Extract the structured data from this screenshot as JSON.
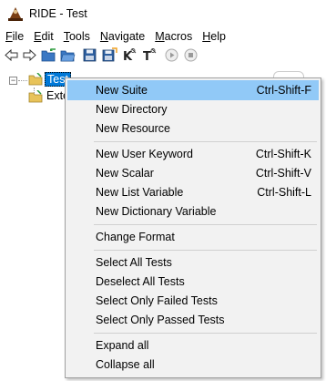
{
  "window": {
    "title": "RIDE - Test"
  },
  "menubar": [
    {
      "mnemonic": "F",
      "rest": "ile"
    },
    {
      "mnemonic": "E",
      "rest": "dit"
    },
    {
      "mnemonic": "T",
      "rest": "ools"
    },
    {
      "mnemonic": "N",
      "rest": "avigate"
    },
    {
      "mnemonic": "M",
      "rest": "acros"
    },
    {
      "mnemonic": "H",
      "rest": "elp"
    }
  ],
  "toolbar": {
    "icons": [
      "back-arrow-icon",
      "forward-arrow-icon",
      "open-suite-icon",
      "open-directory-icon",
      "save-icon",
      "save-all-icon",
      "keyword-search-icon",
      "test-search-icon",
      "run-icon",
      "stop-icon"
    ]
  },
  "tree": {
    "root_label": "Test",
    "child_label": "Exte"
  },
  "context_menu": {
    "items": [
      {
        "label": "New Suite",
        "shortcut": "Ctrl-Shift-F"
      },
      {
        "label": "New Directory",
        "shortcut": ""
      },
      {
        "label": "New Resource",
        "shortcut": ""
      },
      {
        "label": "New User Keyword",
        "shortcut": "Ctrl-Shift-K"
      },
      {
        "label": "New Scalar",
        "shortcut": "Ctrl-Shift-V"
      },
      {
        "label": "New List Variable",
        "shortcut": "Ctrl-Shift-L"
      },
      {
        "label": "New Dictionary Variable",
        "shortcut": ""
      },
      {
        "label": "Change Format",
        "shortcut": ""
      },
      {
        "label": "Select All Tests",
        "shortcut": ""
      },
      {
        "label": "Deselect All Tests",
        "shortcut": ""
      },
      {
        "label": "Select Only Failed Tests",
        "shortcut": ""
      },
      {
        "label": "Select Only Passed Tests",
        "shortcut": ""
      },
      {
        "label": "Expand all",
        "shortcut": ""
      },
      {
        "label": "Collapse all",
        "shortcut": ""
      }
    ]
  },
  "colors": {
    "highlight": "#91c9f7",
    "selection": "#0078d7",
    "menu_bg": "#f2f2f2"
  }
}
